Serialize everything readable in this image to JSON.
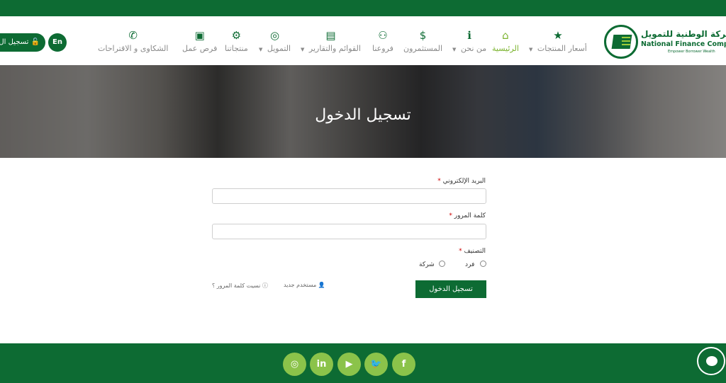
{
  "company": {
    "name_ar": "الشركة الوطنية للتمويل",
    "name_en": "National Finance Company",
    "tagline": "Empower Borrower Wealth"
  },
  "nav": {
    "items": [
      {
        "label": "أسعار المنتجات",
        "icon": "star-icon",
        "glyph": "★"
      },
      {
        "label": "الرئيسية",
        "icon": "home-icon",
        "glyph": "⌂"
      },
      {
        "label": "من نحن",
        "icon": "info-icon",
        "glyph": "ℹ"
      },
      {
        "label": "المستثمرون",
        "icon": "money-icon",
        "glyph": "$"
      },
      {
        "label": "فروعنا",
        "icon": "sitemap-icon",
        "glyph": "⚇"
      },
      {
        "label": "القوائم والتقارير",
        "icon": "file-dollar-icon",
        "glyph": "▤"
      },
      {
        "label": "التمويل",
        "icon": "coins-icon",
        "glyph": "◎"
      },
      {
        "label": "منتجاتنا",
        "icon": "cogs-icon",
        "glyph": "⚙"
      },
      {
        "label": "فرص عمل",
        "icon": "briefcase-icon",
        "glyph": "▣"
      },
      {
        "label": "الشكاوى و الاقتراحات",
        "icon": "phone-icon",
        "glyph": "✆"
      }
    ],
    "language_button": "En",
    "login_button": "تسجيل ال"
  },
  "hero": {
    "title": "تسجيل الدخول"
  },
  "form": {
    "email_label": "البريد الإلكتروني",
    "password_label": "كلمة المرور",
    "classification_label": "التصنيف",
    "required_mark": "*",
    "options": [
      "فرد",
      "شركة"
    ],
    "submit_label": "تسجيل الدخول",
    "new_user_link": "مستخدم جديد",
    "forgot_password_link": "نسيت كلمة المرور ؟"
  },
  "footer": {
    "social": [
      {
        "name": "instagram-icon",
        "glyph": "◎"
      },
      {
        "name": "linkedin-icon",
        "glyph": "in"
      },
      {
        "name": "youtube-icon",
        "glyph": "▶"
      },
      {
        "name": "twitter-icon",
        "glyph": "🐦"
      },
      {
        "name": "facebook-icon",
        "glyph": "f"
      }
    ]
  },
  "colors": {
    "brand_green": "#0d6b33",
    "accent_lime": "#8bc34a"
  }
}
